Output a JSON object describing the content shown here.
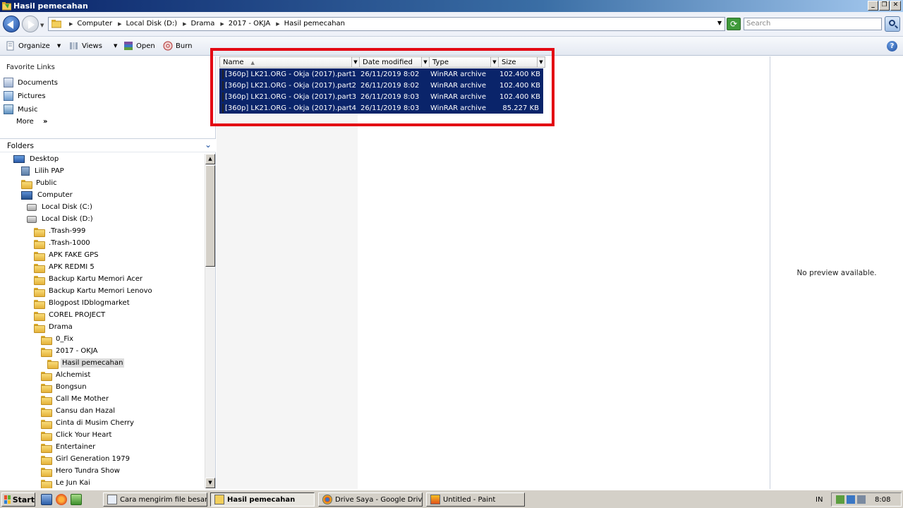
{
  "window": {
    "title": "Hasil pemecahan",
    "controls": {
      "minimize": "_",
      "restore": "❐",
      "close": "✕"
    }
  },
  "address": {
    "crumbs": [
      "Computer",
      "Local Disk (D:)",
      "Drama",
      "2017 - OKJA",
      "Hasil pemecahan"
    ],
    "search_placeholder": "Search"
  },
  "toolbar": {
    "organize": "Organize",
    "views": "Views",
    "open": "Open",
    "burn": "Burn",
    "help": "?"
  },
  "favorites": {
    "heading": "Favorite Links",
    "items": [
      "Documents",
      "Pictures",
      "Music"
    ],
    "more": "More",
    "more_chev": "»"
  },
  "folders": {
    "label": "Folders",
    "tree": [
      {
        "label": "Desktop",
        "icon": "desktop-icon"
      },
      {
        "label": "Lilih PAP",
        "icon": "user-folder-icon"
      },
      {
        "label": "Public",
        "icon": "folder-icon"
      },
      {
        "label": "Computer",
        "icon": "computer-icon"
      },
      {
        "label": "Local Disk (C:)",
        "icon": "drive-icon"
      },
      {
        "label": "Local Disk (D:)",
        "icon": "drive-icon"
      },
      {
        "label": ".Trash-999",
        "icon": "folder-icon"
      },
      {
        "label": ".Trash-1000",
        "icon": "folder-icon"
      },
      {
        "label": "APK FAKE GPS",
        "icon": "folder-icon"
      },
      {
        "label": "APK REDMI 5",
        "icon": "folder-icon"
      },
      {
        "label": "Backup Kartu Memori Acer",
        "icon": "folder-icon"
      },
      {
        "label": "Backup Kartu Memori Lenovo",
        "icon": "folder-icon"
      },
      {
        "label": "Blogpost IDblogmarket",
        "icon": "folder-icon"
      },
      {
        "label": "COREL PROJECT",
        "icon": "folder-icon"
      },
      {
        "label": "Drama",
        "icon": "folder-icon"
      },
      {
        "label": "0_Fix",
        "icon": "folder-icon"
      },
      {
        "label": "2017 - OKJA",
        "icon": "folder-icon"
      },
      {
        "label": "Hasil pemecahan",
        "icon": "folder-icon",
        "selected": true
      },
      {
        "label": "Alchemist",
        "icon": "folder-icon"
      },
      {
        "label": "Bongsun",
        "icon": "folder-icon"
      },
      {
        "label": "Call Me Mother",
        "icon": "folder-icon"
      },
      {
        "label": "Cansu dan Hazal",
        "icon": "folder-icon"
      },
      {
        "label": "Cinta di Musim Cherry",
        "icon": "folder-icon"
      },
      {
        "label": "Click Your Heart",
        "icon": "folder-icon"
      },
      {
        "label": "Entertainer",
        "icon": "folder-icon"
      },
      {
        "label": "Girl Generation 1979",
        "icon": "folder-icon"
      },
      {
        "label": "Hero Tundra Show",
        "icon": "folder-icon"
      },
      {
        "label": "Le Jun Kai",
        "icon": "folder-icon"
      }
    ]
  },
  "filelist": {
    "columns": [
      "Name",
      "Date modified",
      "Type",
      "Size"
    ],
    "rows": [
      {
        "name": "[360p] LK21.ORG - Okja (2017).part1",
        "date": "26/11/2019 8:02",
        "type": "WinRAR archive",
        "size": "102.400 KB"
      },
      {
        "name": "[360p] LK21.ORG - Okja (2017).part2",
        "date": "26/11/2019 8:02",
        "type": "WinRAR archive",
        "size": "102.400 KB"
      },
      {
        "name": "[360p] LK21.ORG - Okja (2017).part3",
        "date": "26/11/2019 8:03",
        "type": "WinRAR archive",
        "size": "102.400 KB"
      },
      {
        "name": "[360p] LK21.ORG - Okja (2017).part4",
        "date": "26/11/2019 8:03",
        "type": "WinRAR archive",
        "size": "85.227 KB"
      }
    ],
    "highlight_color": "#e30613",
    "selection_color": "#0a246a"
  },
  "preview": {
    "message": "No preview available."
  },
  "taskbar": {
    "start": "Start",
    "tasks": [
      {
        "label": "Cara mengirim file besar ...",
        "icon": "document-icon"
      },
      {
        "label": "Hasil pemecahan",
        "icon": "folder-icon",
        "active": true
      },
      {
        "label": "Drive Saya - Google Driv...",
        "icon": "chrome-icon"
      },
      {
        "label": "Untitled - Paint",
        "icon": "paint-icon"
      }
    ],
    "lang": "IN",
    "clock": "8:08"
  }
}
